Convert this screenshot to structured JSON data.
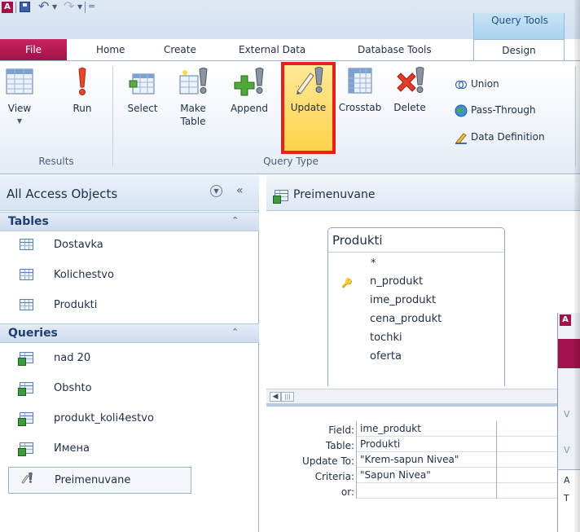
{
  "quick_access": {
    "logo_letter": "A",
    "undo_glyph": "↶",
    "redo_glyph": "↷",
    "menu_glyph": "="
  },
  "context_group": {
    "label": "Query Tools"
  },
  "tabs": {
    "file": "File",
    "home": "Home",
    "create": "Create",
    "external_data": "External Data",
    "database_tools": "Database Tools",
    "design": "Design"
  },
  "ribbon": {
    "results": {
      "label": "Results",
      "view": "View",
      "run": "Run"
    },
    "query_type": {
      "label": "Query Type",
      "select": "Select",
      "make_table_1": "Make",
      "make_table_2": "Table",
      "append": "Append",
      "update": "Update",
      "crosstab": "Crosstab",
      "delete": "Delete",
      "union": "Union",
      "pass_through": "Pass-Through",
      "data_definition": "Data Definition"
    }
  },
  "nav": {
    "title": "All Access Objects",
    "collapse_glyph": "«",
    "tables_header": "Tables",
    "tables": [
      "Dostavka",
      "Kolichestvo",
      "Produkti"
    ],
    "queries_header": "Queries",
    "queries": [
      "nad 20",
      "Obshto",
      "produkt_koli4estvo",
      "Имена",
      "Preimenuvane"
    ]
  },
  "document": {
    "tab_label": "Preimenuvane",
    "field_list": {
      "title": "Produkti",
      "fields": [
        "*",
        "n_produkt",
        "ime_produkt",
        "cena_produkt",
        "tochki",
        "oferta"
      ]
    },
    "grid": {
      "row_labels": [
        "Field:",
        "Table:",
        "Update To:",
        "Criteria:",
        "or:"
      ],
      "column_values": [
        "ime_produkt",
        "Produkti",
        "\"Krem-sapun Nivea\"",
        "\"Sapun Nivea\"",
        ""
      ]
    }
  },
  "overlay_window": {
    "logo_letter": "A",
    "letters": [
      "V",
      "V",
      "A",
      "T"
    ]
  },
  "colors": {
    "file_tab": "#a1124a",
    "highlight_border": "#e8201b",
    "highlight_fill": "#ffd24a",
    "ribbon_bg": "#eef3f9"
  }
}
